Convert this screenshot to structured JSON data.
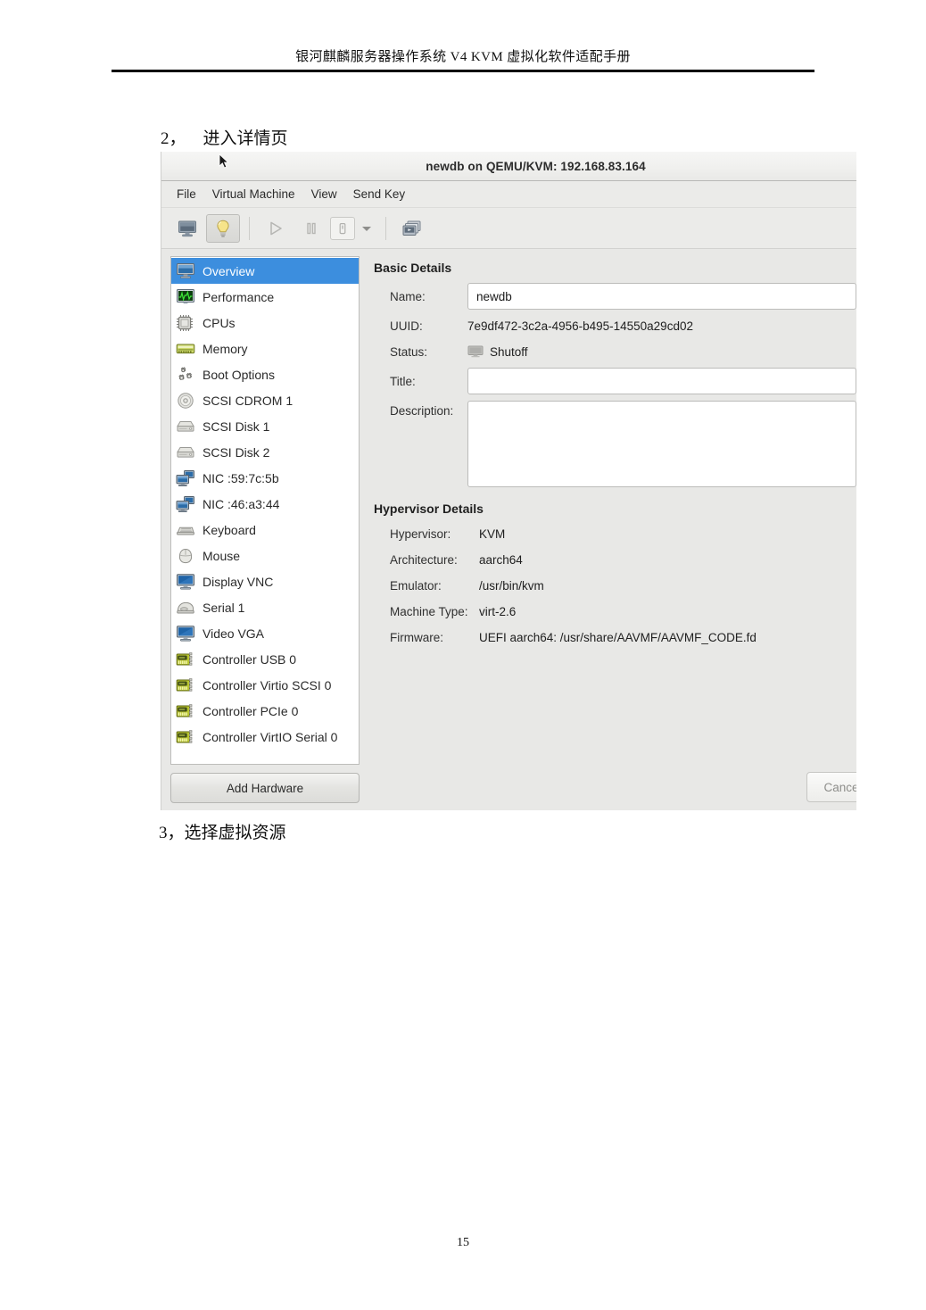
{
  "document": {
    "header_title": "银河麒麟服务器操作系统 V4 KVM 虚拟化软件适配手册",
    "page_number": "15",
    "step_2": "2，    进入详情页",
    "step_3": "3，选择虚拟资源"
  },
  "window": {
    "title": "newdb on QEMU/KVM: 192.168.83.164",
    "menu": [
      {
        "label": "File",
        "name": "menu-file"
      },
      {
        "label": "Virtual Machine",
        "name": "menu-virtual-machine"
      },
      {
        "label": "View",
        "name": "menu-view"
      },
      {
        "label": "Send Key",
        "name": "menu-send-key"
      }
    ],
    "toolbar": [
      {
        "name": "console-view-icon",
        "icon": "monitor"
      },
      {
        "name": "details-view-icon",
        "icon": "lightbulb"
      },
      {
        "name": "run-icon",
        "icon": "play"
      },
      {
        "name": "pause-icon",
        "icon": "pause"
      },
      {
        "name": "shutdown-icon",
        "icon": "power"
      },
      {
        "name": "shutdown-menu-caret-icon",
        "icon": "caret-down"
      },
      {
        "name": "snapshots-icon",
        "icon": "snapshots"
      }
    ]
  },
  "sidebar": {
    "items": [
      {
        "label": "Overview",
        "icon": "monitor",
        "selected": true
      },
      {
        "label": "Performance",
        "icon": "graph",
        "selected": false
      },
      {
        "label": "CPUs",
        "icon": "cpu",
        "selected": false
      },
      {
        "label": "Memory",
        "icon": "memory",
        "selected": false
      },
      {
        "label": "Boot Options",
        "icon": "gears",
        "selected": false
      },
      {
        "label": "SCSI CDROM 1",
        "icon": "cdrom",
        "selected": false
      },
      {
        "label": "SCSI Disk 1",
        "icon": "disk",
        "selected": false
      },
      {
        "label": "SCSI Disk 2",
        "icon": "disk",
        "selected": false
      },
      {
        "label": "NIC :59:7c:5b",
        "icon": "nic",
        "selected": false
      },
      {
        "label": "NIC :46:a3:44",
        "icon": "nic",
        "selected": false
      },
      {
        "label": "Keyboard",
        "icon": "keyboard",
        "selected": false
      },
      {
        "label": "Mouse",
        "icon": "mouse",
        "selected": false
      },
      {
        "label": "Display VNC",
        "icon": "display",
        "selected": false
      },
      {
        "label": "Serial 1",
        "icon": "serial",
        "selected": false
      },
      {
        "label": "Video VGA",
        "icon": "display",
        "selected": false
      },
      {
        "label": "Controller USB 0",
        "icon": "controller",
        "selected": false
      },
      {
        "label": "Controller Virtio SCSI 0",
        "icon": "controller",
        "selected": false
      },
      {
        "label": "Controller PCIe 0",
        "icon": "controller",
        "selected": false
      },
      {
        "label": "Controller VirtIO Serial 0",
        "icon": "controller",
        "selected": false
      }
    ],
    "add_hardware_label": "Add Hardware"
  },
  "details": {
    "basic_title": "Basic Details",
    "name_label": "Name:",
    "name_value": "newdb",
    "uuid_label": "UUID:",
    "uuid_value": "7e9df472-3c2a-4956-b495-14550a29cd02",
    "status_label": "Status:",
    "status_value": "Shutoff",
    "title_label": "Title:",
    "title_value": "",
    "description_label": "Description:",
    "description_value": "",
    "hypervisor_title": "Hypervisor Details",
    "hypervisor_label": "Hypervisor:",
    "hypervisor_value": "KVM",
    "architecture_label": "Architecture:",
    "architecture_value": "aarch64",
    "emulator_label": "Emulator:",
    "emulator_value": "/usr/bin/kvm",
    "machine_type_label": "Machine Type:",
    "machine_type_value": "virt-2.6",
    "firmware_label": "Firmware:",
    "firmware_value": "UEFI aarch64: /usr/share/AAVMF/AAVMF_CODE.fd",
    "cancel_label": "Cance"
  },
  "colors": {
    "selection_blue": "#3c8ede",
    "window_bg": "#e8e8e6",
    "list_bg": "#ffffff"
  }
}
